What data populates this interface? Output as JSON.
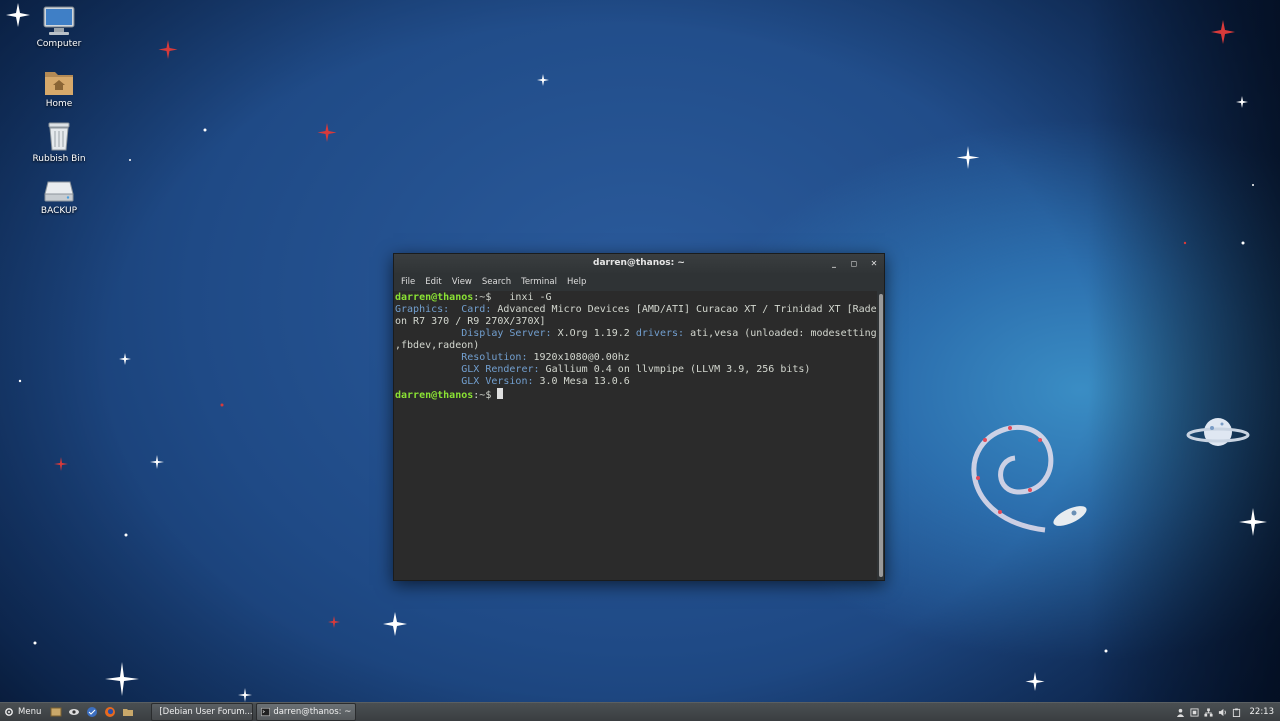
{
  "desktop": {
    "icons": [
      {
        "label": "Computer"
      },
      {
        "label": "Home"
      },
      {
        "label": "Rubbish Bin"
      },
      {
        "label": "BACKUP"
      }
    ]
  },
  "terminal": {
    "title": "darren@thanos: ~",
    "menu": [
      "File",
      "Edit",
      "View",
      "Search",
      "Terminal",
      "Help"
    ],
    "prompt_user": "darren@thanos",
    "prompt_suffix": ":~$ ",
    "command": "  inxi -G",
    "output": {
      "graphics_label": "Graphics:",
      "card_label": "Card:",
      "card_value": "Advanced Micro Devices [AMD/ATI] Curacao XT / Trinidad XT [Rade",
      "card_value2": "on R7 370 / R9 270X/370X]",
      "display_label": "Display Server:",
      "display_value": "X.Org 1.19.2",
      "drivers_label": "drivers:",
      "drivers_value": "ati,vesa (unloaded: modesetting",
      "drivers_value2": ",fbdev,radeon)",
      "resolution_label": "Resolution:",
      "resolution_value": "1920x1080@0.00hz",
      "renderer_label": "GLX Renderer:",
      "renderer_value": "Gallium 0.4 on llvmpipe (LLVM 3.9, 256 bits)",
      "version_label": "GLX Version:",
      "version_value": "3.0 Mesa 13.0.6"
    },
    "prompt2_user": "darren@thanos",
    "prompt2_suffix": ":~$ "
  },
  "panel": {
    "menu_label": "Menu",
    "tasks": [
      {
        "label": "[Debian User Forum..."
      },
      {
        "label": "darren@thanos: ~"
      }
    ],
    "clock": "22:13"
  },
  "colors": {
    "prompt_green": "#8ae234",
    "label_blue": "#729fcf",
    "terminal_bg": "#2b2b2b"
  }
}
